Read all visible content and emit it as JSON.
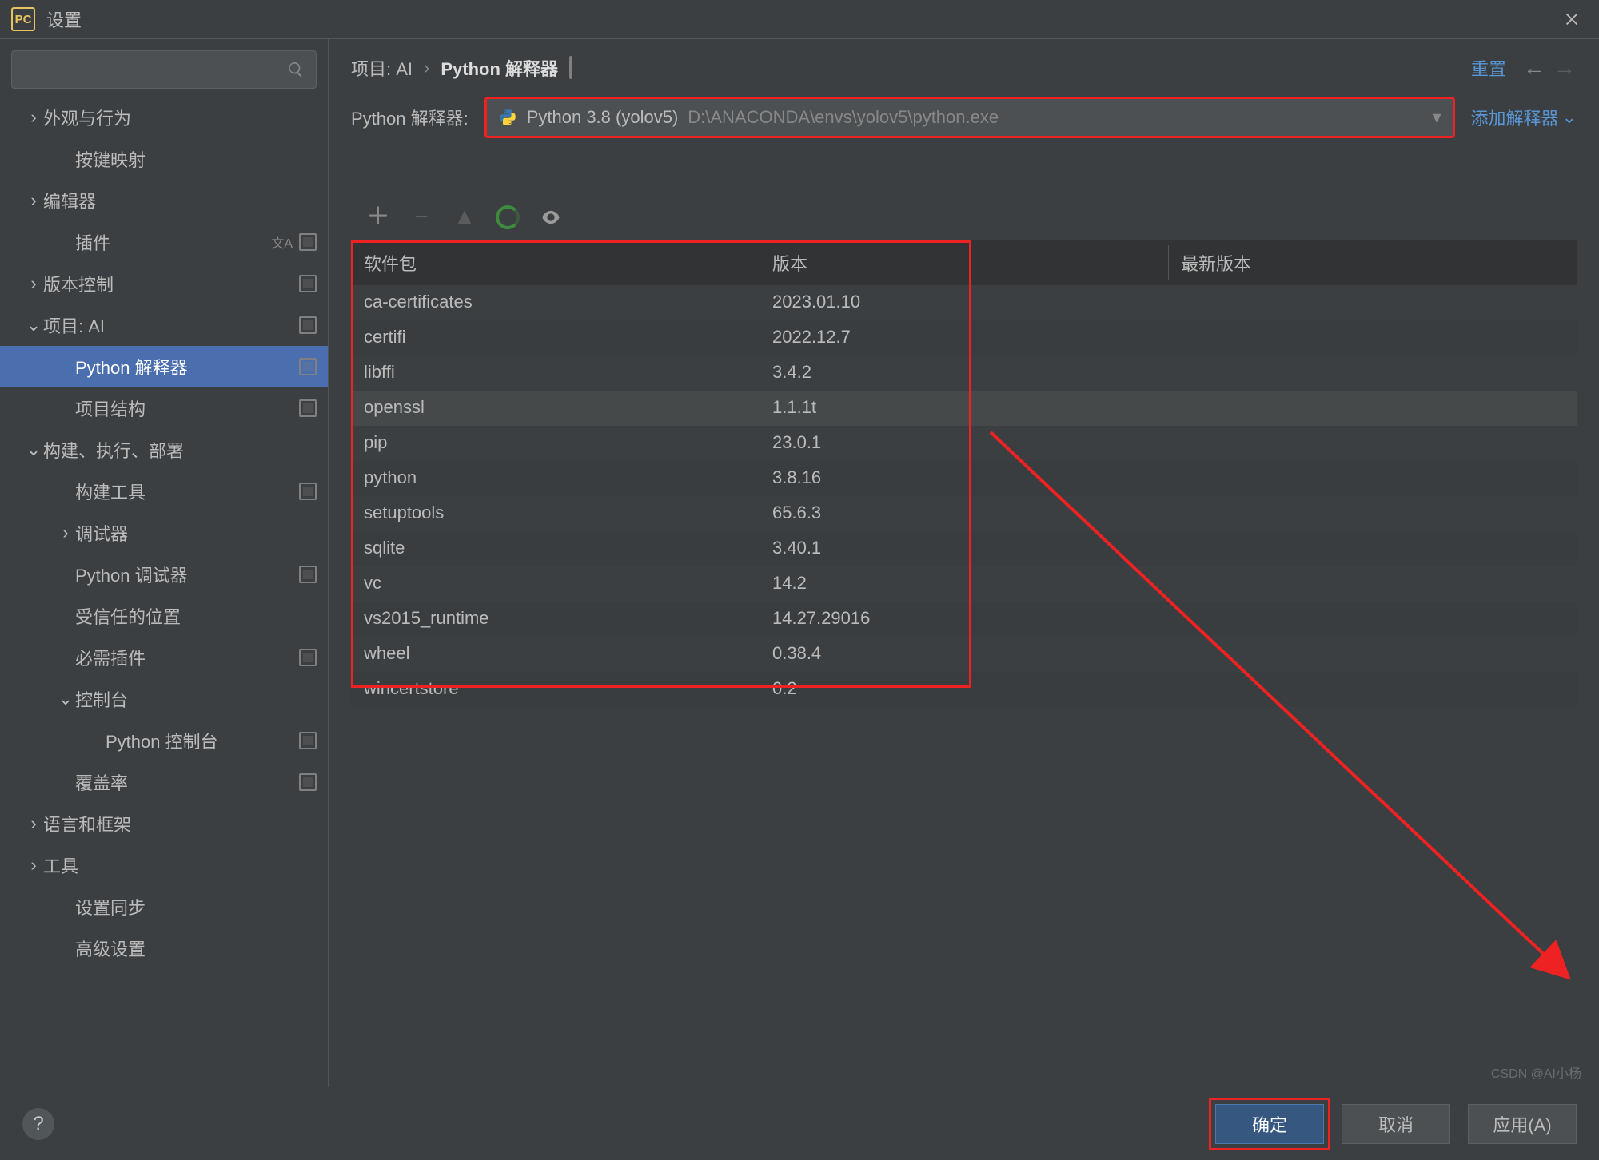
{
  "titlebar": {
    "logo_text": "PC",
    "title": "设置"
  },
  "search": {
    "placeholder": ""
  },
  "sidebar": {
    "items": [
      {
        "label": "外观与行为",
        "chev": "›",
        "depth": 0
      },
      {
        "label": "按键映射",
        "chev": "",
        "depth": 1
      },
      {
        "label": "编辑器",
        "chev": "›",
        "depth": 0
      },
      {
        "label": "插件",
        "chev": "",
        "depth": 1,
        "extra": "lang"
      },
      {
        "label": "版本控制",
        "chev": "›",
        "depth": 0,
        "extra": "sq"
      },
      {
        "label": "项目: AI",
        "chev": "⌄",
        "depth": 0,
        "extra": "sq"
      },
      {
        "label": "Python 解释器",
        "chev": "",
        "depth": 1,
        "extra": "sq",
        "selected": true
      },
      {
        "label": "项目结构",
        "chev": "",
        "depth": 1,
        "extra": "sq"
      },
      {
        "label": "构建、执行、部署",
        "chev": "⌄",
        "depth": 0
      },
      {
        "label": "构建工具",
        "chev": "",
        "depth": 1,
        "extra": "sq"
      },
      {
        "label": "调试器",
        "chev": "›",
        "depth": 1
      },
      {
        "label": "Python 调试器",
        "chev": "",
        "depth": 1,
        "extra": "sq"
      },
      {
        "label": "受信任的位置",
        "chev": "",
        "depth": 1
      },
      {
        "label": "必需插件",
        "chev": "",
        "depth": 1,
        "extra": "sq"
      },
      {
        "label": "控制台",
        "chev": "⌄",
        "depth": 1
      },
      {
        "label": "Python 控制台",
        "chev": "",
        "depth": 2,
        "extra": "sq"
      },
      {
        "label": "覆盖率",
        "chev": "",
        "depth": 1,
        "extra": "sq"
      },
      {
        "label": "语言和框架",
        "chev": "›",
        "depth": 0
      },
      {
        "label": "工具",
        "chev": "›",
        "depth": 0
      },
      {
        "label": "设置同步",
        "chev": "",
        "depth": 1
      },
      {
        "label": "高级设置",
        "chev": "",
        "depth": 1
      }
    ]
  },
  "crumbs": {
    "proj": "项目: AI",
    "sep": "›",
    "page": "Python 解释器"
  },
  "actions": {
    "reset": "重置"
  },
  "interp": {
    "label": "Python 解释器:",
    "value": "Python 3.8 (yolov5)",
    "path": "D:\\ANACONDA\\envs\\yolov5\\python.exe",
    "add": "添加解释器"
  },
  "columns": {
    "pkg": "软件包",
    "ver": "版本",
    "latest": "最新版本"
  },
  "packages": [
    {
      "name": "ca-certificates",
      "ver": "2023.01.10"
    },
    {
      "name": "certifi",
      "ver": "2022.12.7"
    },
    {
      "name": "libffi",
      "ver": "3.4.2"
    },
    {
      "name": "openssl",
      "ver": "1.1.1t",
      "sel": true
    },
    {
      "name": "pip",
      "ver": "23.0.1"
    },
    {
      "name": "python",
      "ver": "3.8.16"
    },
    {
      "name": "setuptools",
      "ver": "65.6.3"
    },
    {
      "name": "sqlite",
      "ver": "3.40.1"
    },
    {
      "name": "vc",
      "ver": "14.2"
    },
    {
      "name": "vs2015_runtime",
      "ver": "14.27.29016"
    },
    {
      "name": "wheel",
      "ver": "0.38.4"
    },
    {
      "name": "wincertstore",
      "ver": "0.2"
    }
  ],
  "buttons": {
    "ok": "确定",
    "cancel": "取消",
    "apply": "应用(A)"
  },
  "watermark": "CSDN @AI小杨"
}
